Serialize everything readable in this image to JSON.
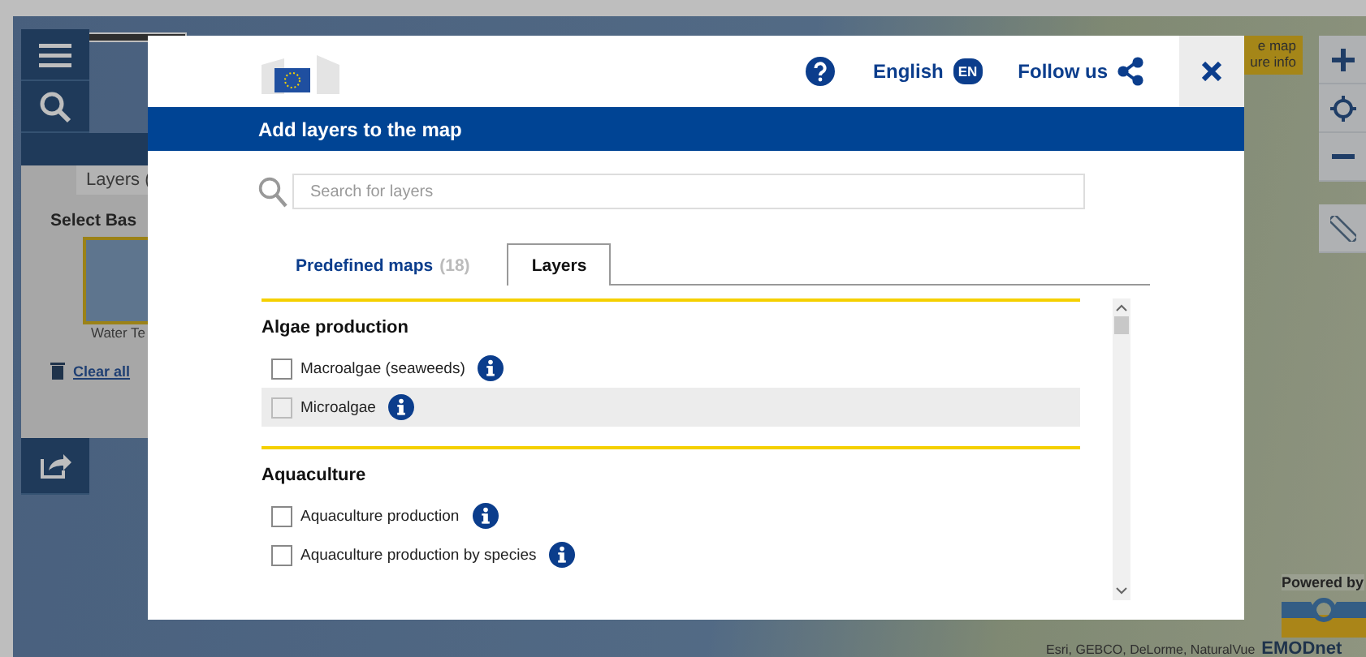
{
  "map_panel": {
    "tab_label": "Layers (",
    "section_title": "Select Bas",
    "basemap_label": "Water Te",
    "clear_link": "Clear all"
  },
  "map_info": {
    "lines": [
      "e map",
      "ure info"
    ]
  },
  "map_footer": {
    "powered_by": "Powered by",
    "attribution": "Esri, GEBCO, DeLorme, NaturalVue",
    "brand": "EMODnet"
  },
  "dialog": {
    "language": "English",
    "language_code": "EN",
    "follow": "Follow us",
    "title": "Add layers to the map",
    "search": {
      "placeholder": "Search for layers"
    },
    "tabs": [
      {
        "label": "Predefined maps",
        "count": "(18)",
        "selected": false
      },
      {
        "label": "Layers",
        "selected": true
      }
    ],
    "groups": [
      {
        "title": "Algae production",
        "items": [
          {
            "label": "Macroalgae (seaweeds)",
            "checked": false,
            "highlighted": false
          },
          {
            "label": "Microalgae",
            "checked": false,
            "highlighted": true
          }
        ]
      },
      {
        "title": "Aquaculture",
        "items": [
          {
            "label": "Aquaculture production",
            "checked": false,
            "highlighted": false
          },
          {
            "label": "Aquaculture production by species",
            "checked": false,
            "highlighted": false
          }
        ]
      }
    ]
  }
}
